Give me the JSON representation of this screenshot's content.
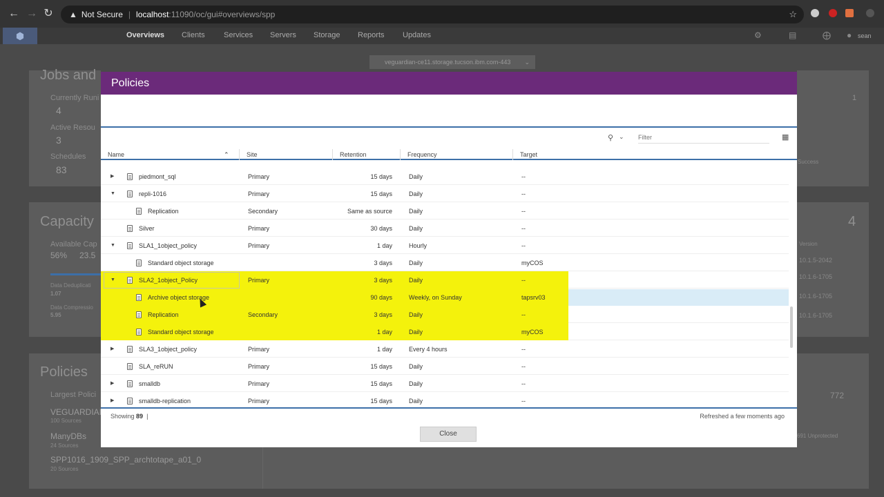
{
  "browser": {
    "security": "Not Secure",
    "url_host": "localhost",
    "url_path": ":11090/oc/gui#overviews/spp"
  },
  "nav": {
    "items": [
      "Overviews",
      "Clients",
      "Services",
      "Servers",
      "Storage",
      "Reports",
      "Updates"
    ],
    "user": "sean"
  },
  "server_selector": "veguardian-ce11.storage.tucson.ibm.com-443",
  "background": {
    "jobs_title": "Jobs and",
    "currently_running_label": "Currently Runi",
    "currently_running": "4",
    "active_resources_label": "Active Resou",
    "active_resources": "3",
    "schedules_label": "Schedules",
    "schedules": "83",
    "right_count_1": "1",
    "success_label": "Success",
    "capacity_title": "Capacity",
    "available_cap_label": "Available Cap",
    "available_pct": "56%",
    "available_val": "23.5",
    "dedup_label": "Data Deduplicati",
    "dedup_val": "1.07",
    "compress_label": "Data Compressio",
    "compress_val": "5.95",
    "right_count_4": "4",
    "version_label": "Version",
    "versions": [
      "10.1.5-2042",
      "10.1.6-1705",
      "10.1.6-1705",
      "10.1.6-1705"
    ],
    "policies_title": "Policies",
    "largest_label": "Largest Polici",
    "policy_list": [
      {
        "name": "VEGUARDIAI",
        "sources": "100 Sources"
      },
      {
        "name": "ManyDBs",
        "sources": "24 Sources"
      },
      {
        "name": "SPP1016_1909_SPP_archtotape_a01_0",
        "sources": "20 Sources"
      }
    ],
    "right_count_772": "772",
    "unprotected": "691 Unprotected"
  },
  "modal": {
    "title": "Policies",
    "filter_placeholder": "Filter",
    "columns": [
      "Name",
      "Site",
      "Retention",
      "Frequency",
      "Target"
    ],
    "rows": [
      {
        "name": "piedmont_sql",
        "site": "Primary",
        "retention": "15 days",
        "frequency": "Daily",
        "target": "--",
        "level": 0,
        "twisty": "right"
      },
      {
        "name": "repli-1016",
        "site": "Primary",
        "retention": "15 days",
        "frequency": "Daily",
        "target": "--",
        "level": 0,
        "twisty": "down"
      },
      {
        "name": "Replication",
        "site": "Secondary",
        "retention": "Same as source",
        "frequency": "Daily",
        "target": "--",
        "level": 1,
        "twisty": ""
      },
      {
        "name": "Silver",
        "site": "Primary",
        "retention": "30 days",
        "frequency": "Daily",
        "target": "--",
        "level": 0,
        "twisty": ""
      },
      {
        "name": "SLA1_1object_policy",
        "site": "Primary",
        "retention": "1 day",
        "frequency": "Hourly",
        "target": "--",
        "level": 0,
        "twisty": "down"
      },
      {
        "name": "Standard object storage",
        "site": "",
        "retention": "3 days",
        "frequency": "Daily",
        "target": "myCOS",
        "level": 1,
        "twisty": ""
      },
      {
        "name": "SLA2_1object_Policy",
        "site": "Primary",
        "retention": "3 days",
        "frequency": "Daily",
        "target": "--",
        "level": 0,
        "twisty": "down",
        "highlight": true
      },
      {
        "name": "Archive object storage",
        "site": "",
        "retention": "90 days",
        "frequency": "Weekly, on Sunday",
        "target": "tapsrv03",
        "level": 1,
        "twisty": "",
        "highlight": true,
        "selected": true
      },
      {
        "name": "Replication",
        "site": "Secondary",
        "retention": "3 days",
        "frequency": "Daily",
        "target": "--",
        "level": 1,
        "twisty": "",
        "highlight": true
      },
      {
        "name": "Standard object storage",
        "site": "",
        "retention": "1 day",
        "frequency": "Daily",
        "target": "myCOS",
        "level": 1,
        "twisty": "",
        "highlight": true
      },
      {
        "name": "SLA3_1object_policy",
        "site": "Primary",
        "retention": "1 day",
        "frequency": "Every 4 hours",
        "target": "--",
        "level": 0,
        "twisty": "right"
      },
      {
        "name": "SLA_reRUN",
        "site": "Primary",
        "retention": "15 days",
        "frequency": "Daily",
        "target": "--",
        "level": 0,
        "twisty": ""
      },
      {
        "name": "smalldb",
        "site": "Primary",
        "retention": "15 days",
        "frequency": "Daily",
        "target": "--",
        "level": 0,
        "twisty": "right"
      },
      {
        "name": "smalldb-replication",
        "site": "Primary",
        "retention": "15 days",
        "frequency": "Daily",
        "target": "--",
        "level": 0,
        "twisty": "right"
      }
    ],
    "showing_label": "Showing",
    "showing_count": "89",
    "refreshed": "Refreshed a few moments ago",
    "close_label": "Close"
  }
}
